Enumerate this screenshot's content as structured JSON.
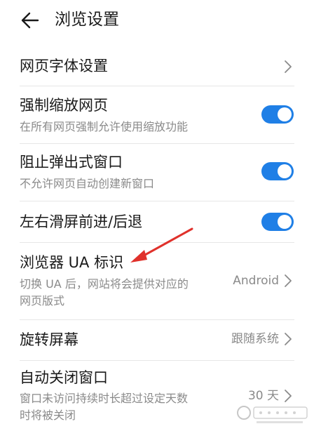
{
  "header": {
    "title": "浏览设置",
    "back_icon": "arrow-left-icon"
  },
  "settings": {
    "font": {
      "title": "网页字体设置"
    },
    "force_zoom": {
      "title": "强制缩放网页",
      "subtitle": "在所有网页强制允许使用缩放功能",
      "enabled": true
    },
    "block_popup": {
      "title": "阻止弹出式窗口",
      "subtitle": "不允许网页自动创建新窗口",
      "enabled": true
    },
    "swipe_nav": {
      "title": "左右滑屏前进/后退",
      "enabled": true
    },
    "ua": {
      "title": "浏览器 UA 标识",
      "subtitle_line1": "切换 UA 后，网站将会提供对应的",
      "subtitle_line2": "网页版式",
      "value": "Android"
    },
    "rotate": {
      "title": "旋转屏幕",
      "value": "跟随系统"
    },
    "auto_close": {
      "title": "自动关闭窗口",
      "subtitle_line1": "窗口未访问持续时长超过设定天数",
      "subtitle_line2": "时将被关闭",
      "value": "30 天"
    }
  },
  "colors": {
    "accent": "#1f7fe6",
    "annotation_arrow": "#e0312b"
  }
}
